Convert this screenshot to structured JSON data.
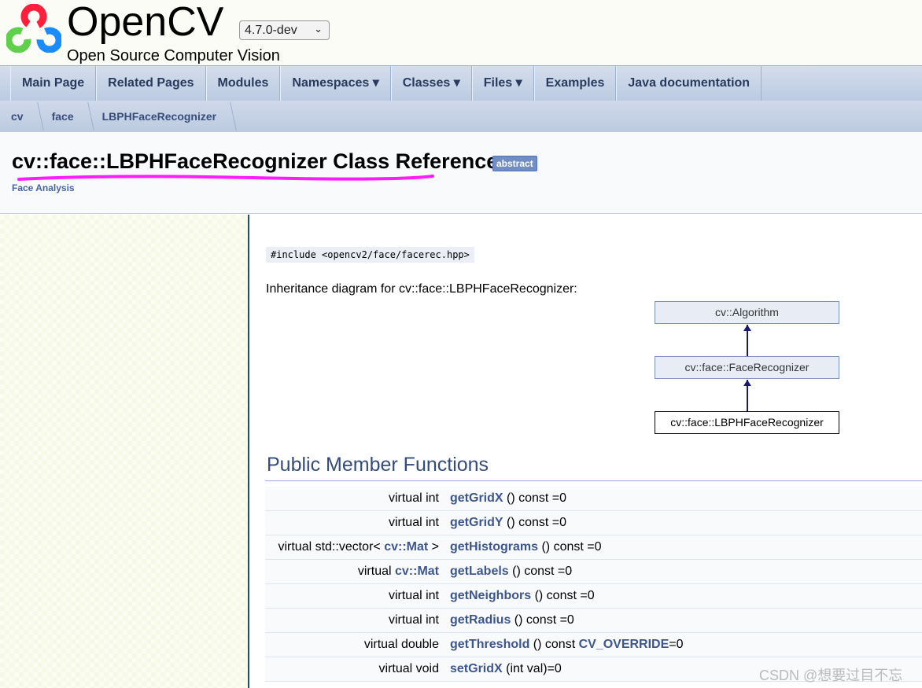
{
  "header": {
    "project_name": "OpenCV",
    "project_brief": "Open Source Computer Vision",
    "version": "4.7.0-dev"
  },
  "nav": [
    "Main Page",
    "Related Pages",
    "Modules",
    "Namespaces ▾",
    "Classes ▾",
    "Files ▾",
    "Examples",
    "Java documentation"
  ],
  "breadcrumb": [
    "cv",
    "face",
    "LBPHFaceRecognizer"
  ],
  "title": "cv::face::LBPHFaceRecognizer Class Reference",
  "badge": "abstract",
  "ingroup": "Face Analysis",
  "include": "#include <opencv2/face/facerec.hpp>",
  "inheritance_label": "Inheritance diagram for cv::face::LBPHFaceRecognizer:",
  "diagram": [
    "cv::Algorithm",
    "cv::face::FaceRecognizer",
    "cv::face::LBPHFaceRecognizer"
  ],
  "section": "Public Member Functions",
  "members": [
    {
      "pre": "virtual int",
      "type_link": "",
      "post": "",
      "name": "getGridX",
      "sig": " () const =0",
      "sig_link": "",
      "sig_end": ""
    },
    {
      "pre": "virtual int",
      "type_link": "",
      "post": "",
      "name": "getGridY",
      "sig": " () const =0",
      "sig_link": "",
      "sig_end": ""
    },
    {
      "pre": "virtual std::vector< ",
      "type_link": "cv::Mat",
      "post": " >",
      "name": "getHistograms",
      "sig": " () const =0",
      "sig_link": "",
      "sig_end": ""
    },
    {
      "pre": "virtual ",
      "type_link": "cv::Mat",
      "post": "",
      "name": "getLabels",
      "sig": " () const =0",
      "sig_link": "",
      "sig_end": ""
    },
    {
      "pre": "virtual int",
      "type_link": "",
      "post": "",
      "name": "getNeighbors",
      "sig": " () const =0",
      "sig_link": "",
      "sig_end": ""
    },
    {
      "pre": "virtual int",
      "type_link": "",
      "post": "",
      "name": "getRadius",
      "sig": " () const =0",
      "sig_link": "",
      "sig_end": ""
    },
    {
      "pre": "virtual double",
      "type_link": "",
      "post": "",
      "name": "getThreshold",
      "sig": " () const ",
      "sig_link": "CV_OVERRIDE",
      "sig_end": "=0"
    },
    {
      "pre": "virtual void",
      "type_link": "",
      "post": "",
      "name": "setGridX",
      "sig": " (int val)=0",
      "sig_link": "",
      "sig_end": ""
    }
  ],
  "watermark": "CSDN @想要过目不忘",
  "colors": {
    "link": "#3d578c",
    "heading": "#354c7b",
    "badge": "#728dc1",
    "highlight_underline": "#ff00ff"
  }
}
